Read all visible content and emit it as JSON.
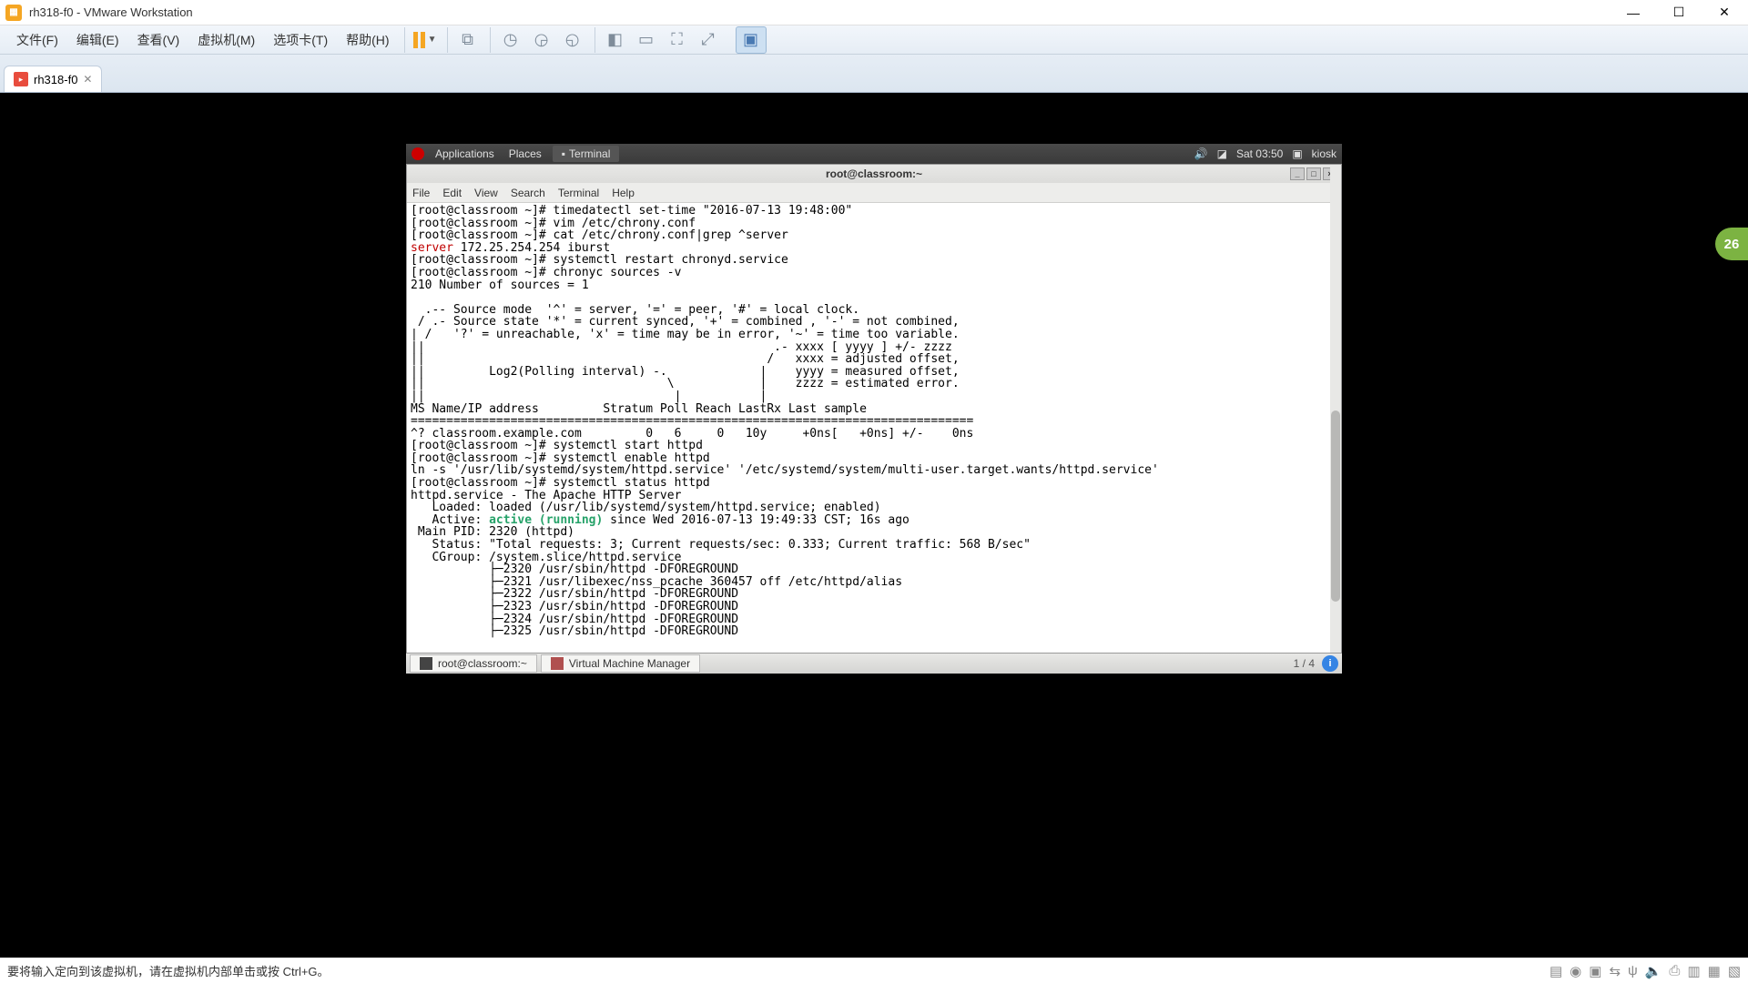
{
  "vmware": {
    "title": "rh318-f0 - VMware Workstation",
    "menus": {
      "file": "文件(F)",
      "edit": "编辑(E)",
      "view": "查看(V)",
      "vm": "虚拟机(M)",
      "tabs": "选项卡(T)",
      "help": "帮助(H)"
    },
    "tab": {
      "name": "rh318-f0"
    },
    "status_hint": "要将输入定向到该虚拟机，请在虚拟机内部单击或按 Ctrl+G。"
  },
  "gnome": {
    "applications": "Applications",
    "places": "Places",
    "terminal": "Terminal",
    "time": "Sat 03:50",
    "user": "kiosk",
    "taskbar": {
      "term": "root@classroom:~",
      "vmm": "Virtual Machine Manager"
    },
    "workspace": "1 / 4"
  },
  "terminal": {
    "title": "root@classroom:~",
    "menus": {
      "file": "File",
      "edit": "Edit",
      "view": "View",
      "search": "Search",
      "terminal": "Terminal",
      "help": "Help"
    },
    "body": "[root@classroom ~]# timedatectl set-time \"2016-07-13 19:48:00\"\n[root@classroom ~]# vim /etc/chrony.conf\n[root@classroom ~]# cat /etc/chrony.conf|grep ^server\n__SERVER__ 172.25.254.254 iburst\n[root@classroom ~]# systemctl restart chronyd.service\n[root@classroom ~]# chronyc sources -v\n210 Number of sources = 1\n\n  .-- Source mode  '^' = server, '=' = peer, '#' = local clock.\n / .- Source state '*' = current synced, '+' = combined , '-' = not combined,\n| /   '?' = unreachable, 'x' = time may be in error, '~' = time too variable.\n||                                                 .- xxxx [ yyyy ] +/- zzzz\n||                                                /   xxxx = adjusted offset,\n||         Log2(Polling interval) -.             |    yyyy = measured offset,\n||                                  \\            |    zzzz = estimated error.\n||                                   |           |\nMS Name/IP address         Stratum Poll Reach LastRx Last sample\n===============================================================================\n^? classroom.example.com         0   6     0   10y     +0ns[   +0ns] +/-    0ns\n[root@classroom ~]# systemctl start httpd\n[root@classroom ~]# systemctl enable httpd\nln -s '/usr/lib/systemd/system/httpd.service' '/etc/systemd/system/multi-user.target.wants/httpd.service'\n[root@classroom ~]# systemctl status httpd\nhttpd.service - The Apache HTTP Server\n   Loaded: loaded (/usr/lib/systemd/system/httpd.service; enabled)\n   Active: __ACTIVE__ since Wed 2016-07-13 19:49:33 CST; 16s ago\n Main PID: 2320 (httpd)\n   Status: \"Total requests: 3; Current requests/sec: 0.333; Current traffic: 568 B/sec\"\n   CGroup: /system.slice/httpd.service\n           ├─2320 /usr/sbin/httpd -DFOREGROUND\n           ├─2321 /usr/libexec/nss_pcache 360457 off /etc/httpd/alias\n           ├─2322 /usr/sbin/httpd -DFOREGROUND\n           ├─2323 /usr/sbin/httpd -DFOREGROUND\n           ├─2324 /usr/sbin/httpd -DFOREGROUND\n           ├─2325 /usr/sbin/httpd -DFOREGROUND",
    "server_kw": "server",
    "active_kw": "active (running)"
  },
  "badge": "26"
}
